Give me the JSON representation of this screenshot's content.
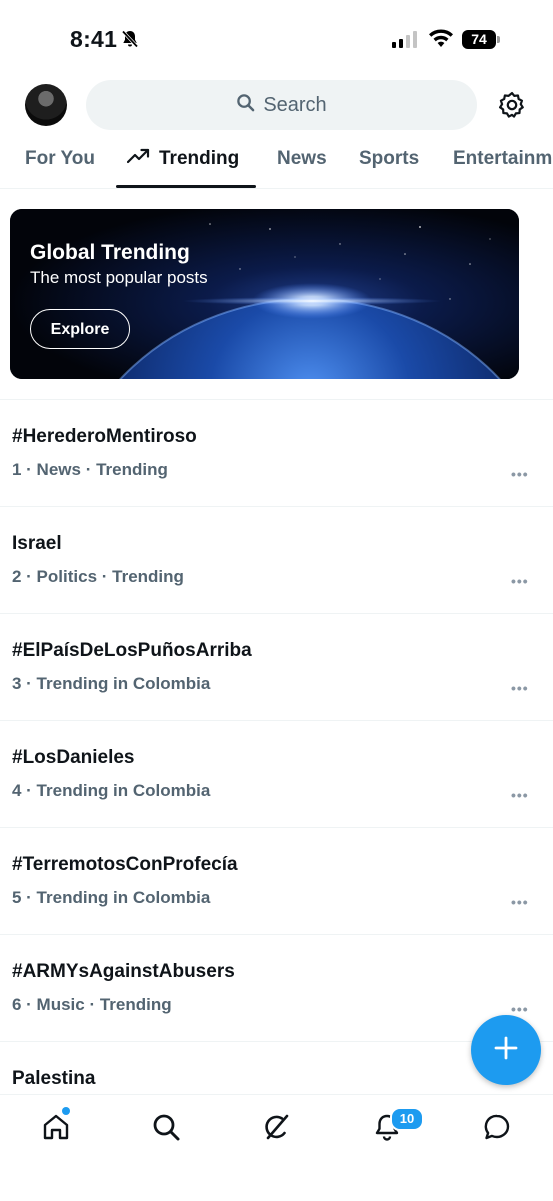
{
  "status_bar": {
    "time": "8:41",
    "battery": "74"
  },
  "search": {
    "placeholder": "Search"
  },
  "tabs": [
    {
      "label": "For You",
      "active": false
    },
    {
      "label": "Trending",
      "active": true
    },
    {
      "label": "News",
      "active": false
    },
    {
      "label": "Sports",
      "active": false
    },
    {
      "label": "Entertainment",
      "active": false
    }
  ],
  "banner": {
    "title": "Global Trending",
    "subtitle": "The most popular posts",
    "button_label": "Explore"
  },
  "trends": [
    {
      "name": "#HerederoMentiroso",
      "meta": "1 · News · Trending"
    },
    {
      "name": "Israel",
      "meta": "2 · Politics · Trending"
    },
    {
      "name": "#ElPaísDeLosPuñosArriba",
      "meta": "3 · Trending in Colombia"
    },
    {
      "name": "#LosDanieles",
      "meta": "4 · Trending in Colombia"
    },
    {
      "name": "#TerremotosConProfecía",
      "meta": "5 · Trending in Colombia"
    },
    {
      "name": "#ARMYsAgainstAbusers",
      "meta": "6 · Music · Trending"
    },
    {
      "name": "Palestina",
      "meta": ""
    }
  ],
  "bottom_nav": {
    "notifications_count": "10"
  },
  "colors": {
    "accent": "#1d9bf0",
    "text_primary": "#0f1419",
    "text_secondary": "#536471"
  }
}
